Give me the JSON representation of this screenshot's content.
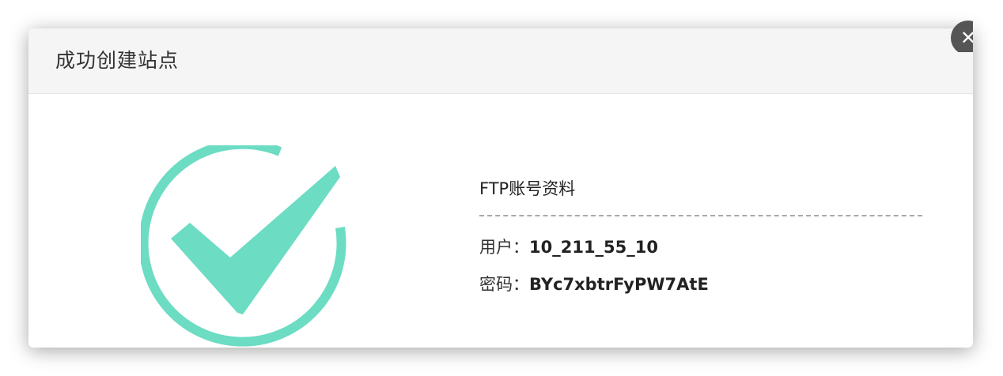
{
  "dialog": {
    "title": "成功创建站点",
    "close_icon": "close-icon"
  },
  "success": {
    "icon": "check-circle-icon",
    "color": "#6cdcc3"
  },
  "ftp": {
    "heading": "FTP账号资料",
    "user_label": "用户：",
    "user_value": "10_211_55_10",
    "password_label": "密码：",
    "password_value": "BYc7xbtrFyPW7AtE"
  }
}
